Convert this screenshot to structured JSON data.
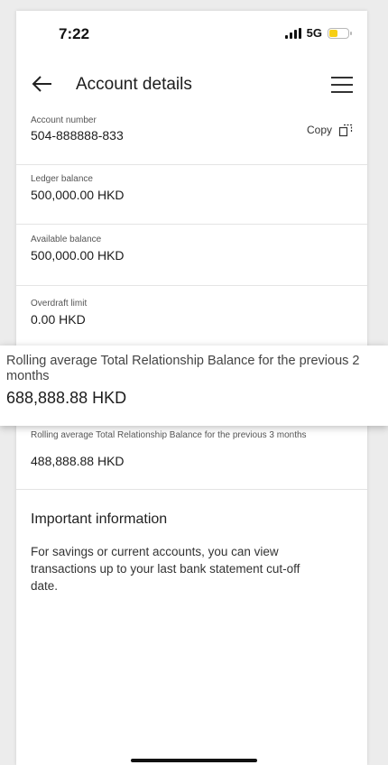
{
  "status_bar": {
    "time": "7:22",
    "network": "5G",
    "icons": [
      "signal-icon",
      "battery-icon"
    ],
    "battery_color": "#f7cf15"
  },
  "header": {
    "title": "Account details",
    "back_icon": "arrow-left-icon",
    "menu_icon": "hamburger-menu-icon"
  },
  "account_number": {
    "label": "Account number",
    "value": "504-888888-833",
    "copy_label": "Copy",
    "copy_icon": "copy-icon"
  },
  "ledger_balance": {
    "label": "Ledger balance",
    "value": "500,000.00 HKD"
  },
  "available_balance": {
    "label": "Available balance",
    "value": "500,000.00 HKD"
  },
  "overdraft_limit": {
    "label": "Overdraft limit",
    "value": "0.00 HKD"
  },
  "trb_2_months": {
    "label": "Rolling average Total Relationship Balance for the previous 2 months",
    "value": "688,888.88 HKD"
  },
  "trb_3_months": {
    "label": "Rolling average Total Relationship Balance for the previous 3 months",
    "value": "488,888.88 HKD"
  },
  "important_information": {
    "title": "Important information",
    "body": "For savings or current accounts, you can view transactions up to your last bank statement cut-off date."
  }
}
